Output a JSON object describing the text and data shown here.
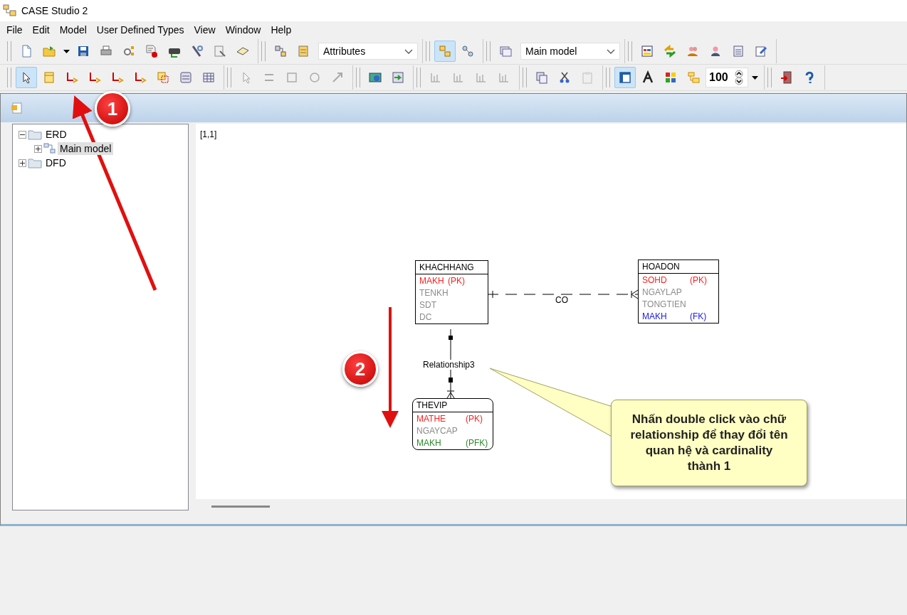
{
  "window": {
    "title": "CASE Studio 2"
  },
  "menu": [
    "File",
    "Edit",
    "Model",
    "User Defined Types",
    "View",
    "Window",
    "Help"
  ],
  "toolbars": [
    [
      [
        {
          "kind": "button",
          "selected": false,
          "disabled": false
        },
        {
          "kind": "button",
          "selected": false,
          "disabled": false
        },
        {
          "kind": "caret"
        },
        {
          "kind": "button",
          "selected": false,
          "disabled": false
        },
        {
          "kind": "button",
          "selected": false,
          "disabled": false
        },
        {
          "kind": "button",
          "selected": false,
          "disabled": false
        },
        {
          "kind": "button",
          "selected": false,
          "disabled": false
        },
        {
          "kind": "button",
          "selected": false,
          "disabled": false
        },
        {
          "kind": "button",
          "selected": false,
          "disabled": false
        },
        {
          "kind": "button",
          "selected": false,
          "disabled": false
        },
        {
          "kind": "button",
          "selected": false,
          "disabled": false
        }
      ],
      [
        {
          "kind": "button",
          "selected": false,
          "disabled": false
        },
        {
          "kind": "button",
          "selected": false,
          "disabled": false
        },
        {
          "kind": "dropdown",
          "value": "Attributes"
        }
      ],
      [
        {
          "kind": "button",
          "selected": true,
          "disabled": false
        },
        {
          "kind": "button",
          "selected": false,
          "disabled": false
        }
      ],
      [
        {
          "kind": "button",
          "selected": false,
          "disabled": false
        },
        {
          "kind": "dropdown",
          "value": "Main model"
        }
      ],
      [
        {
          "kind": "button",
          "selected": false,
          "disabled": false
        },
        {
          "kind": "button",
          "selected": false,
          "disabled": false
        },
        {
          "kind": "button",
          "selected": false,
          "disabled": false
        },
        {
          "kind": "button",
          "selected": false,
          "disabled": false
        },
        {
          "kind": "button",
          "selected": false,
          "disabled": false
        },
        {
          "kind": "button",
          "selected": false,
          "disabled": false
        }
      ]
    ],
    [
      [
        {
          "kind": "button",
          "selected": true,
          "disabled": false
        },
        {
          "kind": "button",
          "selected": false,
          "disabled": false
        },
        {
          "kind": "button",
          "selected": false,
          "disabled": false
        },
        {
          "kind": "button",
          "selected": false,
          "disabled": false
        },
        {
          "kind": "button",
          "selected": false,
          "disabled": false
        },
        {
          "kind": "button",
          "selected": false,
          "disabled": false
        },
        {
          "kind": "button",
          "selected": false,
          "disabled": false
        },
        {
          "kind": "button",
          "selected": false,
          "disabled": false
        },
        {
          "kind": "button",
          "selected": false,
          "disabled": false
        }
      ],
      [
        {
          "kind": "button",
          "selected": false,
          "disabled": true
        },
        {
          "kind": "button",
          "selected": false,
          "disabled": true
        },
        {
          "kind": "button",
          "selected": false,
          "disabled": true
        },
        {
          "kind": "button",
          "selected": false,
          "disabled": true
        },
        {
          "kind": "button",
          "selected": false,
          "disabled": true
        }
      ],
      [
        {
          "kind": "button",
          "selected": false,
          "disabled": false
        },
        {
          "kind": "button",
          "selected": false,
          "disabled": false
        }
      ],
      [
        {
          "kind": "button",
          "selected": false,
          "disabled": true
        },
        {
          "kind": "button",
          "selected": false,
          "disabled": true
        },
        {
          "kind": "button",
          "selected": false,
          "disabled": true
        },
        {
          "kind": "button",
          "selected": false,
          "disabled": true
        }
      ],
      [
        {
          "kind": "button",
          "selected": false,
          "disabled": false
        },
        {
          "kind": "button",
          "selected": false,
          "disabled": false
        },
        {
          "kind": "button",
          "selected": false,
          "disabled": true
        }
      ],
      [
        {
          "kind": "button",
          "selected": true,
          "disabled": false
        },
        {
          "kind": "button",
          "selected": false,
          "disabled": false
        },
        {
          "kind": "button",
          "selected": false,
          "disabled": false
        },
        {
          "kind": "button",
          "selected": false,
          "disabled": false
        },
        {
          "kind": "spin",
          "value": "100"
        },
        {
          "kind": "caret"
        }
      ],
      [
        {
          "kind": "button",
          "selected": false,
          "disabled": false
        },
        {
          "kind": "button",
          "selected": false,
          "disabled": false
        }
      ]
    ]
  ],
  "tree": [
    {
      "label": "ERD",
      "expanded": true,
      "selected": false,
      "children": [
        {
          "label": "Main model",
          "expanded": false,
          "selected": true
        }
      ]
    },
    {
      "label": "DFD",
      "expanded": false,
      "selected": false
    }
  ],
  "canvas": {
    "coords": "[1,1]",
    "entities": [
      {
        "name": "KHACHHANG",
        "kind": "independent",
        "attributes": [
          {
            "name": "MAKH",
            "key": "(PK)",
            "color": "#ff2020"
          },
          {
            "name": "TENKH",
            "color": "#8c8c8c"
          },
          {
            "name": "SDT",
            "color": "#8c8c8c"
          },
          {
            "name": "DC",
            "color": "#8c8c8c"
          }
        ]
      },
      {
        "name": "HOADON",
        "kind": "independent",
        "attributes": [
          {
            "name": "SOHD",
            "key": "(PK)",
            "color": "#ff2020"
          },
          {
            "name": "NGAYLAP",
            "color": "#8c8c8c"
          },
          {
            "name": "TONGTIEN",
            "color": "#8c8c8c"
          },
          {
            "name": "MAKH",
            "key": "(FK)",
            "color": "#2020e0"
          }
        ]
      },
      {
        "name": "THEVIP",
        "kind": "dependent",
        "attributes": [
          {
            "name": "MATHE",
            "key": "(PK)",
            "color": "#ff2020"
          },
          {
            "name": "NGAYCAP",
            "color": "#8c8c8c"
          },
          {
            "name": "MAKH",
            "key": "(PFK)",
            "color": "#2a8a2a"
          }
        ]
      }
    ],
    "relationships": [
      {
        "label": "CO",
        "kind": "non-identifying"
      },
      {
        "label": "Relationship3",
        "kind": "identifying"
      }
    ]
  },
  "annotations": {
    "badges": [
      "1",
      "2"
    ],
    "callout": "Nhấn double click vào chữ relationship để thay đổi tên quan hệ và cardinality thành 1"
  }
}
